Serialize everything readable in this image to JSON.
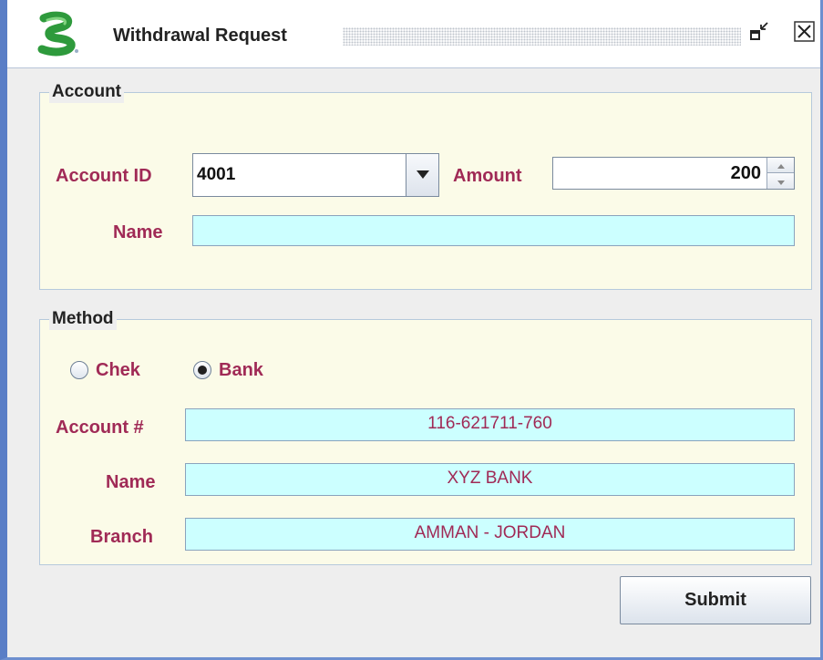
{
  "window": {
    "title": "Withdrawal Request",
    "logo_icon": "green-s-logo-icon",
    "restore_icon": "restore-window-icon",
    "close_icon": "close-window-icon"
  },
  "account_group": {
    "title": "Account",
    "account_id_label": "Account ID",
    "account_id_value": "4001",
    "amount_label": "Amount",
    "amount_value": "200",
    "name_label": "Name",
    "name_value": ""
  },
  "method_group": {
    "title": "Method",
    "options": [
      {
        "label": "Chek",
        "selected": false
      },
      {
        "label": "Bank",
        "selected": true
      }
    ],
    "account_no_label": "Account #",
    "account_no_value": "116-621711-760",
    "bank_name_label": "Name",
    "bank_name_value": "XYZ BANK",
    "branch_label": "Branch",
    "branch_value": "AMMAN - JORDAN"
  },
  "submit_label": "Submit",
  "colors": {
    "label": "#a02a56",
    "panel_background": "#fbfbe8",
    "readonly_field": "#ccffff",
    "window_border": "#5a7ec6"
  }
}
